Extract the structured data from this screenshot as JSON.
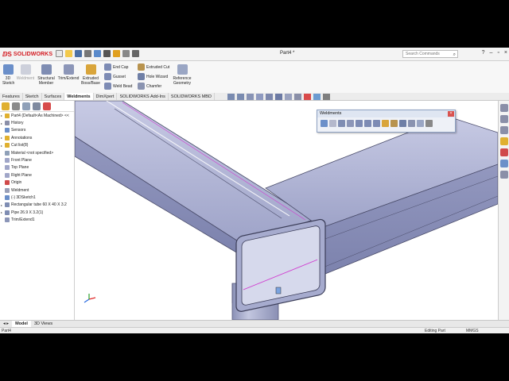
{
  "app": {
    "brand": "SOLIDWORKS",
    "doc_title": "Part4 *",
    "search_placeholder": "Search Commands"
  },
  "ribbon": {
    "sketch3d": "3D\nSketch",
    "weldment": "Weldment",
    "structural_member": "Structural\nMember",
    "trim_extend": "Trim/Extend",
    "extruded_boss": "Extruded\nBoss/Base",
    "end_cap": "End Cap",
    "gusset": "Gusset",
    "weld_bead": "Weld Bead",
    "extruded_cut": "Extruded Cut",
    "hole_wizard": "Hole Wizard",
    "chamfer": "Chamfer",
    "reference_geometry": "Reference\nGeometry"
  },
  "tabs": [
    "Features",
    "Sketch",
    "Surfaces",
    "Weldments",
    "DimXpert",
    "SOLIDWORKS Add-Ins",
    "SOLIDWORKS MBD"
  ],
  "active_tab": "Weldments",
  "tree": [
    {
      "label": "Part4  (Default<As Machined> <<",
      "icon": "part-icon",
      "arrow": "▸"
    },
    {
      "label": "History",
      "icon": "history-icon",
      "arrow": "▸"
    },
    {
      "label": "Sensors",
      "icon": "sensor-icon",
      "arrow": ""
    },
    {
      "label": "Annotations",
      "icon": "annotation-icon",
      "arrow": "▸"
    },
    {
      "label": "Cut list(8)",
      "icon": "cutlist-icon",
      "arrow": "▸"
    },
    {
      "label": "Material <not specified>",
      "icon": "material-icon",
      "arrow": ""
    },
    {
      "label": "Front Plane",
      "icon": "plane-icon",
      "arrow": ""
    },
    {
      "label": "Top Plane",
      "icon": "plane-icon",
      "arrow": ""
    },
    {
      "label": "Right Plane",
      "icon": "plane-icon",
      "arrow": ""
    },
    {
      "label": "Origin",
      "icon": "origin-icon",
      "arrow": ""
    },
    {
      "label": "Weldment",
      "icon": "weldment-icon",
      "arrow": ""
    },
    {
      "label": "(-) 3DSketch1",
      "icon": "sketch-icon",
      "arrow": ""
    },
    {
      "label": "Rectangular tube 60 X 40 X 3.2",
      "icon": "member-icon",
      "arrow": "▸"
    },
    {
      "label": "Pipe 26.9 X 3.2(1)",
      "icon": "member-icon",
      "arrow": "▸"
    },
    {
      "label": "Trim/Extend1",
      "icon": "trim-icon",
      "arrow": ""
    }
  ],
  "weldments_toolbar": {
    "title": "Weldments"
  },
  "bottom_tabs": [
    "Model",
    "3D Views"
  ],
  "active_bottom_tab": "Model",
  "status": {
    "doc": "Part4",
    "mode": "Editing Part",
    "units": "MMGS"
  },
  "colors": {
    "accent": "#d31920",
    "tube": "#a9aed0",
    "edge": "#4a4c6a",
    "highlight": "#d040d0"
  }
}
